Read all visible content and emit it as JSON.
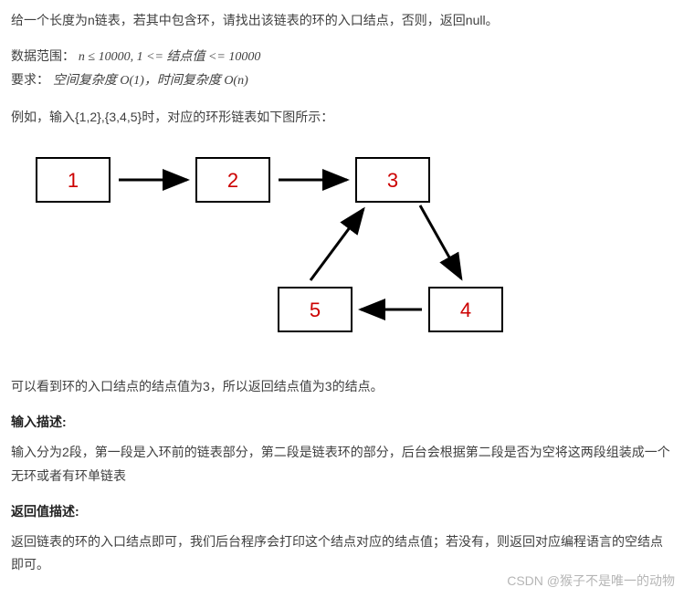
{
  "intro": "给一个长度为n链表，若其中包含环，请找出该链表的环的入口结点，否则，返回null。",
  "range_prefix": "数据范围：",
  "range_formula_html": "n ≤ 10000, 1 <= 结点值 <= 10000",
  "require_prefix": "要求：",
  "require_text": "空间复杂度 O(1)，时间复杂度 O(n)",
  "example_prefix": "例如，输入{1,2},{3,4,5}时，对应的环形链表如下图所示：",
  "nodes": {
    "n1": "1",
    "n2": "2",
    "n3": "3",
    "n4": "4",
    "n5": "5"
  },
  "observation": "可以看到环的入口结点的结点值为3，所以返回结点值为3的结点。",
  "input_title": "输入描述:",
  "input_desc": "输入分为2段，第一段是入环前的链表部分，第二段是链表环的部分，后台会根据第二段是否为空将这两段组装成一个无环或者有环单链表",
  "return_title": "返回值描述:",
  "return_desc": "返回链表的环的入口结点即可，我们后台程序会打印这个结点对应的结点值；若没有，则返回对应编程语言的空结点即可。",
  "watermark": "CSDN @猴子不是唯一的动物"
}
